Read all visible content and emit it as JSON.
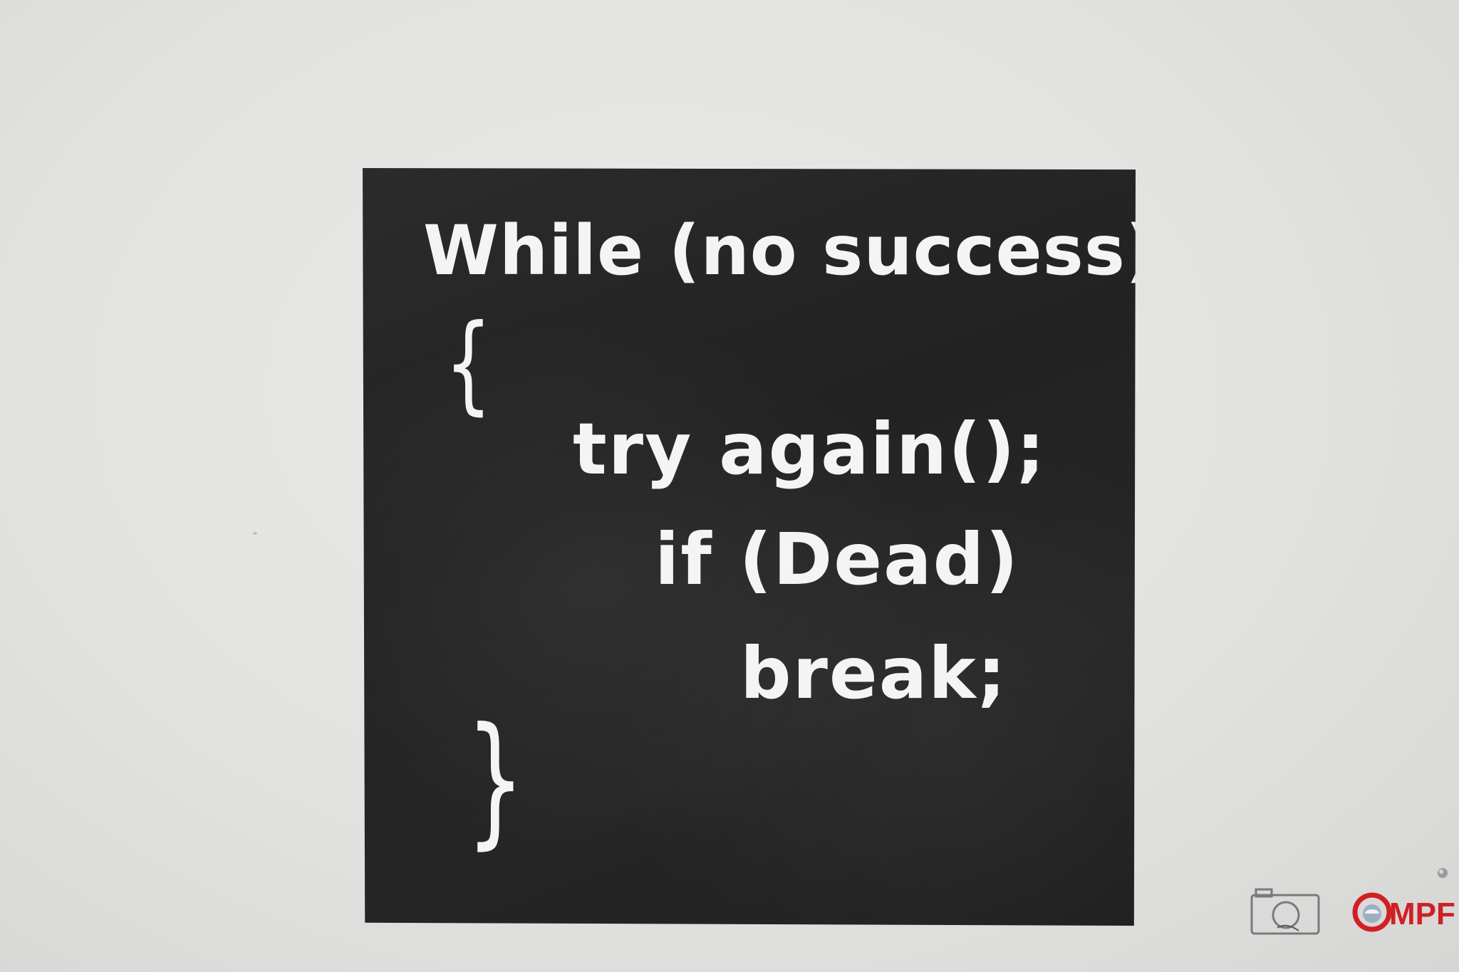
{
  "poster": {
    "lines": [
      "While (no success)",
      "{",
      "try again();",
      "if (Dead)",
      "break;",
      "}"
    ]
  },
  "watermark": {
    "camera_icon": "camera-icon",
    "brand_text": "MPF",
    "brand_logo_icon": "globe-icon"
  },
  "colors": {
    "wall": "#e2e2e0",
    "poster": "#242424",
    "text": "#f4f4f4",
    "brand_red": "#d11f26"
  }
}
